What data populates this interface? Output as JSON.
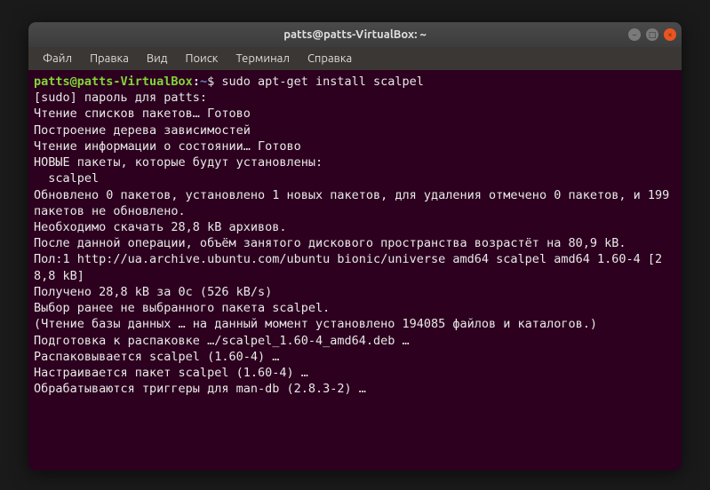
{
  "titlebar": {
    "title": "patts@patts-VirtualBox: ~"
  },
  "menubar": {
    "items": [
      "Файл",
      "Правка",
      "Вид",
      "Поиск",
      "Терминал",
      "Справка"
    ]
  },
  "prompt": {
    "user_host": "patts@patts-VirtualBox",
    "colon": ":",
    "path": "~",
    "dollar": "$"
  },
  "command": " sudo apt-get install scalpel",
  "output_lines": [
    "[sudo] пароль для patts:",
    "Чтение списков пакетов… Готово",
    "Построение дерева зависимостей",
    "Чтение информации о состоянии… Готово",
    "НОВЫЕ пакеты, которые будут установлены:",
    "  scalpel",
    "Обновлено 0 пакетов, установлено 1 новых пакетов, для удаления отмечено 0 пакетов, и 199 пакетов не обновлено.",
    "Необходимо скачать 28,8 kB архивов.",
    "После данной операции, объём занятого дискового пространства возрастёт на 80,9 kB.",
    "Пол:1 http://ua.archive.ubuntu.com/ubuntu bionic/universe amd64 scalpel amd64 1.60-4 [28,8 kB]",
    "Получено 28,8 kB за 0с (526 kB/s)",
    "Выбор ранее не выбранного пакета scalpel.",
    "(Чтение базы данных … на данный момент установлено 194085 файлов и каталогов.)",
    "Подготовка к распаковке …/scalpel_1.60-4_amd64.deb …",
    "Распаковывается scalpel (1.60-4) …",
    "Настраивается пакет scalpel (1.60-4) …",
    "Обрабатываются триггеры для man-db (2.8.3-2) …"
  ]
}
